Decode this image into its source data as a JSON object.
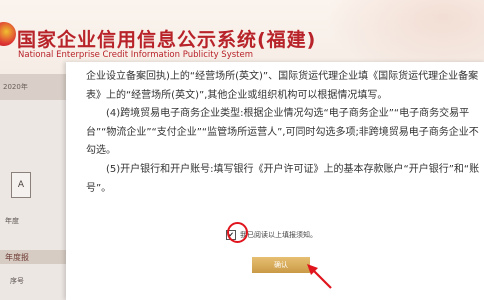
{
  "header": {
    "title_cn": "国家企业信用信息公示系统(福建)",
    "title_en": "National Enterprise Credit Information Publicity System"
  },
  "background": {
    "date_label": "2020年",
    "box_char": "A",
    "annual_label": "年度",
    "bar_label": "年度报",
    "seq_label": "序号"
  },
  "modal": {
    "paragraphs": [
      "企业设立备案回执)上的“经营场所(英文)”、国际货运代理企业填《国际货运代理企业备案表》上的“经营场所(英文)”,其他企业或组织机构可以根据情况填写。",
      "(4)跨境贸易电子商务企业类型:根据企业情况勾选“电子商务企业”“电子商务交易平台”“物流企业”“支付企业”“监管场所运营人”,可同时勾选多项;非跨境贸易电子商务企业不勾选。",
      "(5)开户银行和开户账号:填写银行《开户许可证》上的基本存款账户“开户银行”和“账号”。"
    ],
    "agree_checked": true,
    "agree_label": "我已阅读以上填报须知。",
    "confirm_label": "确认"
  },
  "colors": {
    "brand_red": "#b8232a",
    "annotation_red": "#e0141c",
    "confirm_gold": "#d7a955"
  }
}
